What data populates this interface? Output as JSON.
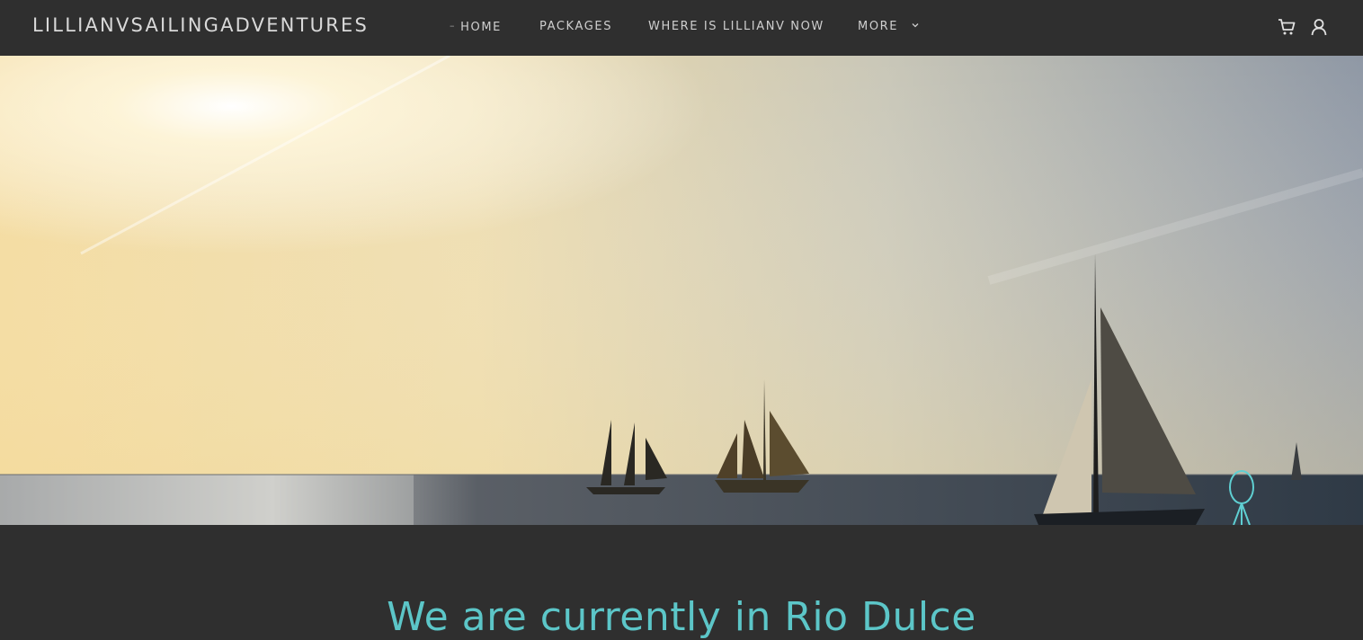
{
  "site": {
    "brand": "LILLIANVSAILINGADVENTURES"
  },
  "nav": {
    "items": [
      {
        "label": "HOME",
        "active": true
      },
      {
        "label": "PACKAGES"
      },
      {
        "label": "WHERE IS LILLIANV NOW"
      },
      {
        "label": "MORE",
        "has_dropdown": true
      }
    ]
  },
  "header_icons": [
    "cart-icon",
    "user-icon"
  ],
  "hero": {
    "image": "sailboats-at-sunset"
  },
  "main": {
    "headline": "We are currently in Rio Dulce"
  },
  "colors": {
    "background": "#2f2f2f",
    "accent": "#5cc6c8",
    "nav_text": "#cfcfcf"
  }
}
